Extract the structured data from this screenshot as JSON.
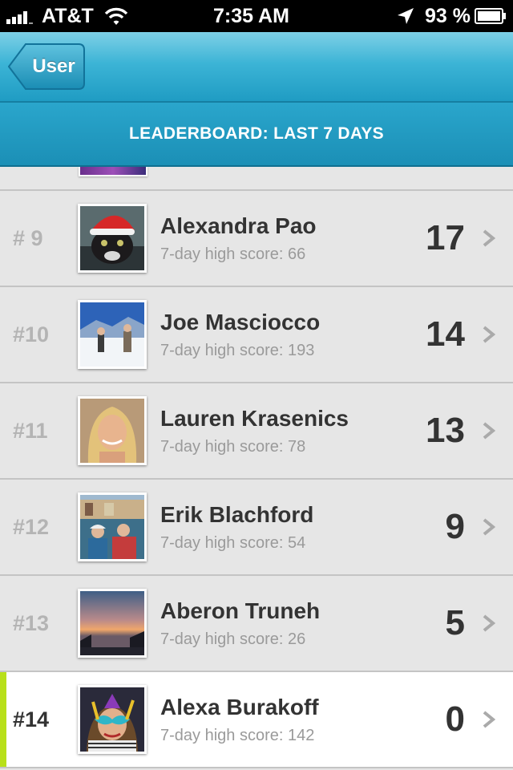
{
  "status_bar": {
    "carrier": "AT&T",
    "time": "7:35 AM",
    "battery": "93 %",
    "icons": [
      "signal-bars-icon",
      "wifi-icon",
      "location-arrow-icon",
      "battery-icon"
    ]
  },
  "nav": {
    "back_label": "User"
  },
  "header": {
    "title": "LEADERBOARD: LAST 7 DAYS"
  },
  "colors": {
    "nav_gradient_top": "#7ed0e6",
    "nav_gradient_bottom": "#1f9cc3",
    "current_user_accent": "#b8e01a"
  },
  "leaderboard": {
    "rows": [
      {
        "rank": "# 9",
        "name": "Alexandra Pao",
        "high_score": "7-day high score: 66",
        "score": "17",
        "avatar": "cat-santa-hat-photo"
      },
      {
        "rank": "#10",
        "name": "Joe Masciocco",
        "high_score": "7-day high score: 193",
        "score": "14",
        "avatar": "ski-slope-photo"
      },
      {
        "rank": "#11",
        "name": "Lauren Krasenics",
        "high_score": "7-day high score: 78",
        "score": "13",
        "avatar": "portrait-photo"
      },
      {
        "rank": "#12",
        "name": "Erik Blachford",
        "high_score": "7-day high score: 54",
        "score": "9",
        "avatar": "harbor-couple-photo"
      },
      {
        "rank": "#13",
        "name": "Aberon Truneh",
        "high_score": "7-day high score: 26",
        "score": "5",
        "avatar": "sunset-photo"
      },
      {
        "rank": "#14",
        "name": "Alexa Burakoff",
        "high_score": "7-day high score: 142",
        "score": "0",
        "avatar": "carnival-mask-photo",
        "current_user": true
      }
    ]
  }
}
